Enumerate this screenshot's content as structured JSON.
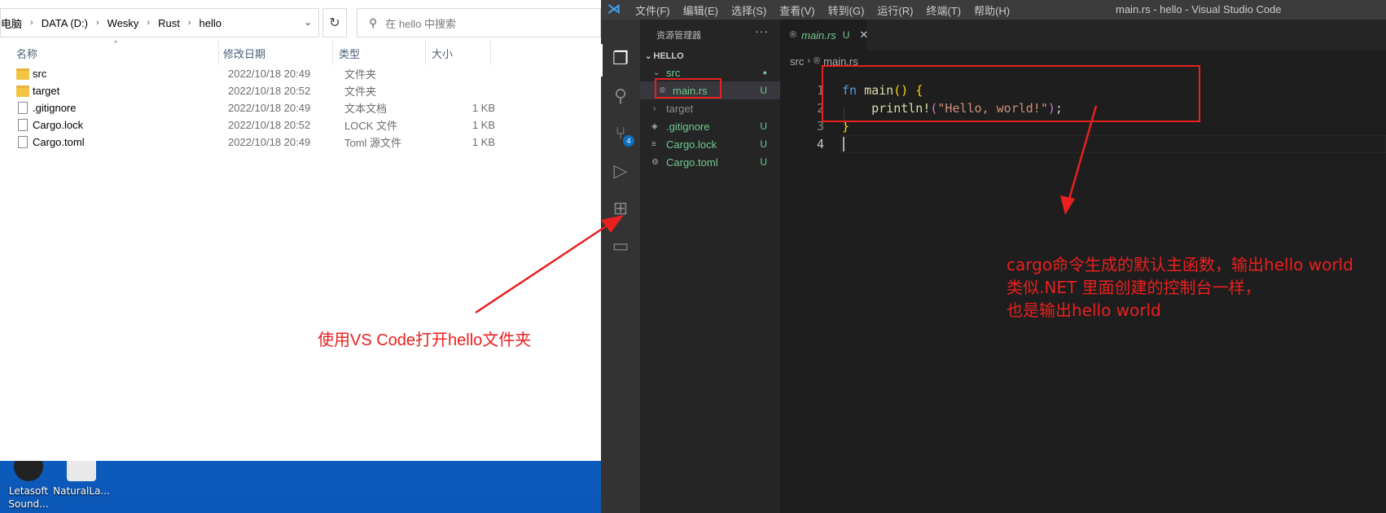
{
  "desktop": {
    "icons": [
      {
        "label_1": "Letasoft",
        "label_2": "Sound..."
      },
      {
        "label_1": "NaturalLa...",
        "label_2": ""
      }
    ]
  },
  "explorer": {
    "breadcrumb": [
      "电脑",
      "DATA (D:)",
      "Wesky",
      "Rust",
      "hello"
    ],
    "search_placeholder": "在 hello 中搜索",
    "columns": {
      "name": "名称",
      "date": "修改日期",
      "type": "类型",
      "size": "大小"
    },
    "files": [
      {
        "name": "src",
        "date": "2022/10/18 20:49",
        "type": "文件夹",
        "size": "",
        "icon": "folder-icon"
      },
      {
        "name": "target",
        "date": "2022/10/18 20:52",
        "type": "文件夹",
        "size": "",
        "icon": "folder-icon"
      },
      {
        "name": ".gitignore",
        "date": "2022/10/18 20:49",
        "type": "文本文档",
        "size": "1 KB",
        "icon": "text-file-icon"
      },
      {
        "name": "Cargo.lock",
        "date": "2022/10/18 20:52",
        "type": "LOCK 文件",
        "size": "1 KB",
        "icon": "file-icon"
      },
      {
        "name": "Cargo.toml",
        "date": "2022/10/18 20:49",
        "type": "Toml 源文件",
        "size": "1 KB",
        "icon": "file-icon"
      }
    ]
  },
  "vscode": {
    "menu": [
      "文件(F)",
      "编辑(E)",
      "选择(S)",
      "查看(V)",
      "转到(G)",
      "运行(R)",
      "终端(T)",
      "帮助(H)"
    ],
    "window_title": "main.rs - hello - Visual Studio Code",
    "sidebar": {
      "title": "资源管理器",
      "more": "···",
      "section": "HELLO",
      "items": [
        {
          "label": "src",
          "status": "●"
        },
        {
          "label": "main.rs",
          "status": "U"
        },
        {
          "label": "target",
          "status": ""
        },
        {
          "label": ".gitignore",
          "status": "U"
        },
        {
          "label": "Cargo.lock",
          "status": "U"
        },
        {
          "label": "Cargo.toml",
          "status": "U"
        }
      ]
    },
    "scm_badge": "4",
    "tab": {
      "label": "main.rs",
      "status": "U"
    },
    "breadcrumb": {
      "folder": "src",
      "file": "main.rs"
    },
    "code": {
      "line_numbers": [
        "1",
        "2",
        "3",
        "4"
      ],
      "line1": {
        "kw": "fn",
        "name": "main",
        "paren_open": "(",
        "paren_close": ")",
        "brace": "{"
      },
      "line2": {
        "macro": "println!",
        "open": "(",
        "string": "\"Hello, world!\"",
        "close": ")",
        "end": ";"
      },
      "line3": {
        "brace": "}"
      }
    }
  },
  "annotations": {
    "explorer_note": "使用VS Code打开hello文件夹",
    "code_note": [
      "cargo命令生成的默认主函数，输出hello world",
      "类似.NET 里面创建的控制台一样，",
      "也是输出hello world"
    ],
    "color": "#e8201f"
  }
}
